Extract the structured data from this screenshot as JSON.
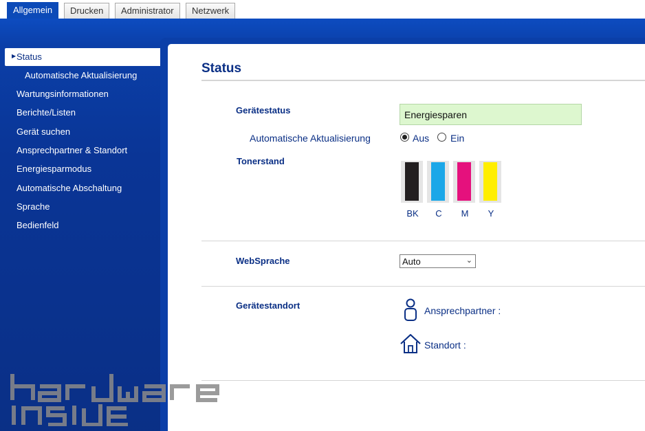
{
  "tabs": [
    {
      "label": "Allgemein",
      "active": true
    },
    {
      "label": "Drucken",
      "active": false
    },
    {
      "label": "Administrator",
      "active": false
    },
    {
      "label": "Netzwerk",
      "active": false
    }
  ],
  "sidebar": {
    "active": "Status",
    "items": [
      {
        "label": "Automatische Aktualisierung",
        "sub": true
      },
      {
        "label": "Wartungsinformationen"
      },
      {
        "label": "Berichte/Listen"
      },
      {
        "label": "Gerät suchen"
      },
      {
        "label": "Ansprechpartner & Standort"
      },
      {
        "label": "Energiesparmodus"
      },
      {
        "label": "Automatische Abschaltung"
      },
      {
        "label": "Sprache"
      },
      {
        "label": "Bedienfeld"
      }
    ]
  },
  "main": {
    "title": "Status",
    "device_status_label": "Gerätestatus",
    "device_status_value": "Energiesparen",
    "auto_update_label": "Automatische Aktualisierung",
    "auto_update_options": {
      "off": "Aus",
      "on": "Ein",
      "selected": "Aus"
    },
    "toner_label": "Tonerstand",
    "toners": [
      {
        "name": "BK",
        "color": "#231f20"
      },
      {
        "name": "C",
        "color": "#1ba7e8"
      },
      {
        "name": "M",
        "color": "#e5117d"
      },
      {
        "name": "Y",
        "color": "#ffee00"
      }
    ],
    "web_language_label": "WebSprache",
    "web_language_value": "Auto",
    "location_label": "Gerätestandort",
    "contact_label": "Ansprechpartner :",
    "site_label": "Standort :"
  },
  "watermark": {
    "logo_text": "hardware inside"
  },
  "colors": {
    "brand_blue": "#0a2f85",
    "accent_blue": "#0c4ab8",
    "status_green": "#ddf7cf"
  }
}
